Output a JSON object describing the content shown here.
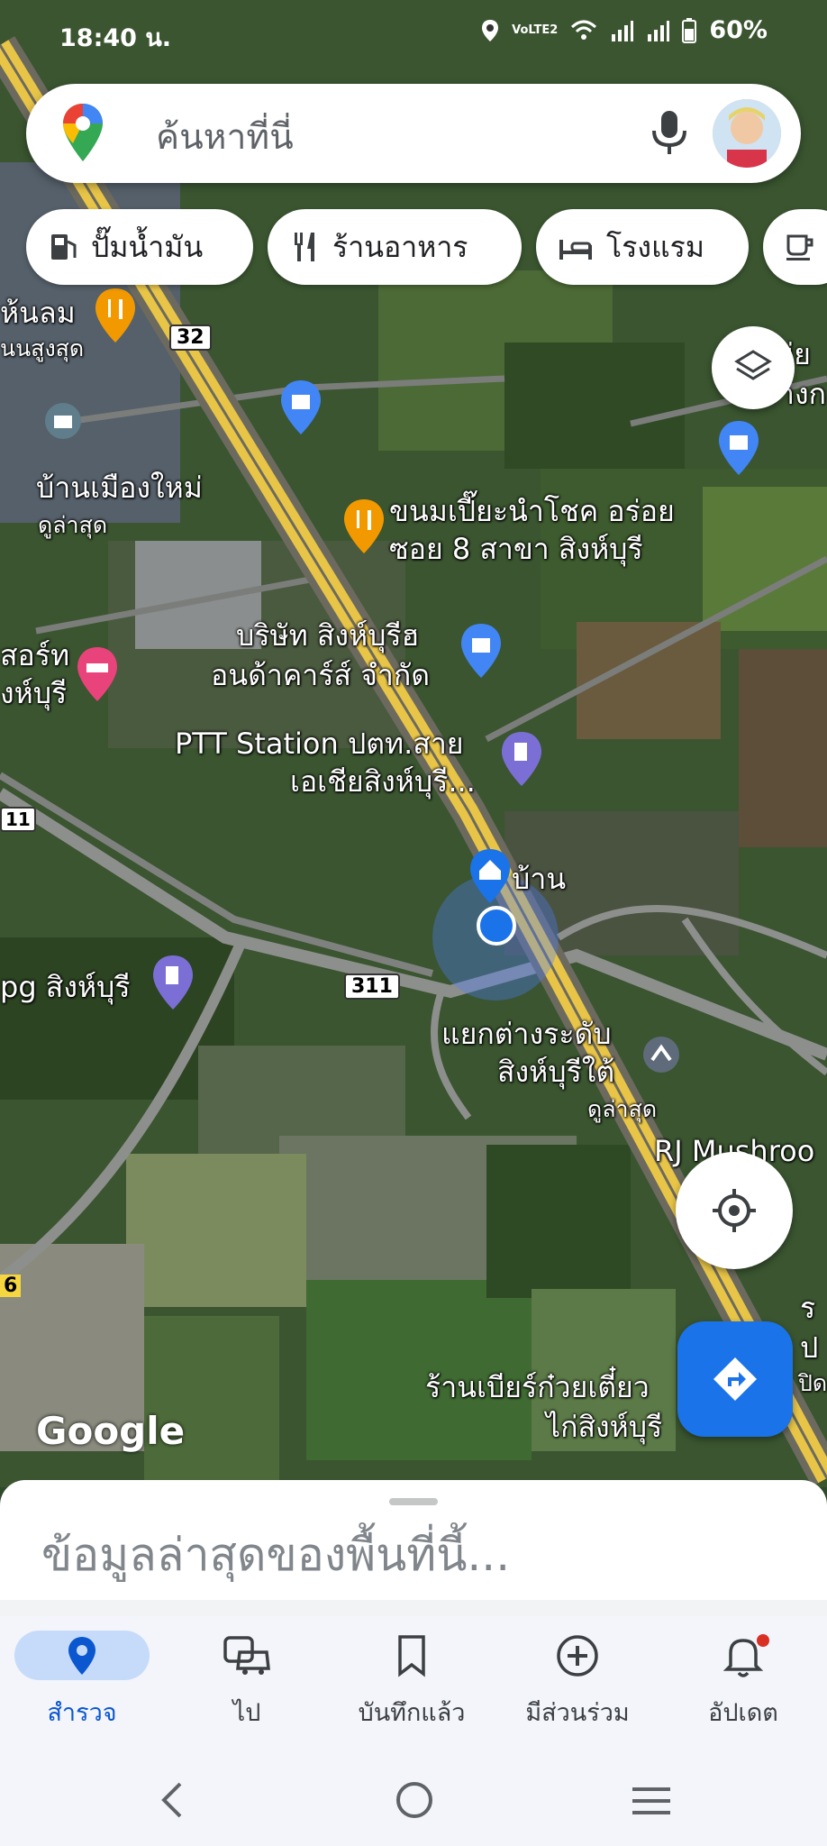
{
  "status_bar": {
    "time": "18:40 น.",
    "battery": "60%",
    "network_label": "VoLTE2"
  },
  "search": {
    "placeholder": "ค้นหาที่นี่"
  },
  "chips": [
    {
      "label": "ปั๊มน้ำมัน",
      "icon": "gas-station-icon"
    },
    {
      "label": "ร้านอาหาร",
      "icon": "restaurant-icon"
    },
    {
      "label": "โรงแรม",
      "icon": "hotel-icon"
    },
    {
      "label": "",
      "icon": "coffee-icon"
    }
  ],
  "map": {
    "watermark": "Google",
    "labels": {
      "l1": "ห้นลม",
      "l2": "นนสูงสุด",
      "l3": "32",
      "l4": "บ้านเมืองใหม่",
      "l5": "ดูล่าสุด",
      "l6": "ขนมเปี๊ยะนำโชค อร่อย",
      "l7": "ซอย 8 สาขา สิงห์บุรี",
      "l8": "บริษัท สิงห์บุรีฮ",
      "l9": "อนด้าคาร์ส์ จำกัด",
      "l10": "สอร์ท",
      "l11": "งห์บุรี",
      "l12": "PTT Station ปตท.สาย",
      "l13": "เอเชียสิงห์บุรี...",
      "l14": "11",
      "l15": "บ้าน",
      "l16": "pg สิงห์บุรี",
      "l17": "311",
      "l18": "แยกต่างระดับ",
      "l19": "สิงห์บุรีใต้",
      "l20": "ดูล่าสุด",
      "l21": "RJ Mushroo",
      "l22": "ร้านเบียร์ก๋วยเตี๋ยว",
      "l23": "ไก่สิงห์บุรี",
      "l24": "6",
      "l25": "ร",
      "l26": "ป",
      "l27": "ปิด",
      "l28": "มุ่ย",
      "l29": "างก"
    }
  },
  "sheet": {
    "title": "ข้อมูลล่าสุดของพื้นที่นี้..."
  },
  "bottom_nav": [
    {
      "label": "สำรวจ",
      "icon": "explore-pin-icon",
      "active": true
    },
    {
      "label": "ไป",
      "icon": "commute-icon",
      "active": false
    },
    {
      "label": "บันทึกแล้ว",
      "icon": "bookmark-icon",
      "active": false
    },
    {
      "label": "มีส่วนร่วม",
      "icon": "add-circle-icon",
      "active": false
    },
    {
      "label": "อัปเดต",
      "icon": "bell-icon",
      "active": false
    }
  ],
  "colors": {
    "accent": "#1a73e8",
    "highway": "#e8c547",
    "road": "#8d8f8d"
  }
}
